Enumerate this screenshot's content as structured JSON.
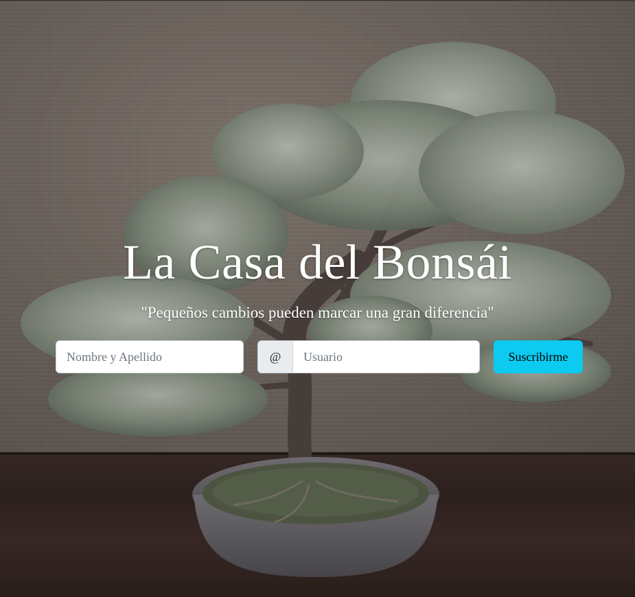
{
  "hero": {
    "title": "La Casa del Bonsái",
    "tagline": "\"Pequeños cambios pueden marcar una gran diferencia\""
  },
  "form": {
    "name_placeholder": "Nombre y Apellido",
    "at_symbol": "@",
    "user_placeholder": "Usuario",
    "submit_label": "Suscribirme"
  },
  "colors": {
    "button_accent": "#0dcaf0",
    "title_text": "#ffffff"
  }
}
